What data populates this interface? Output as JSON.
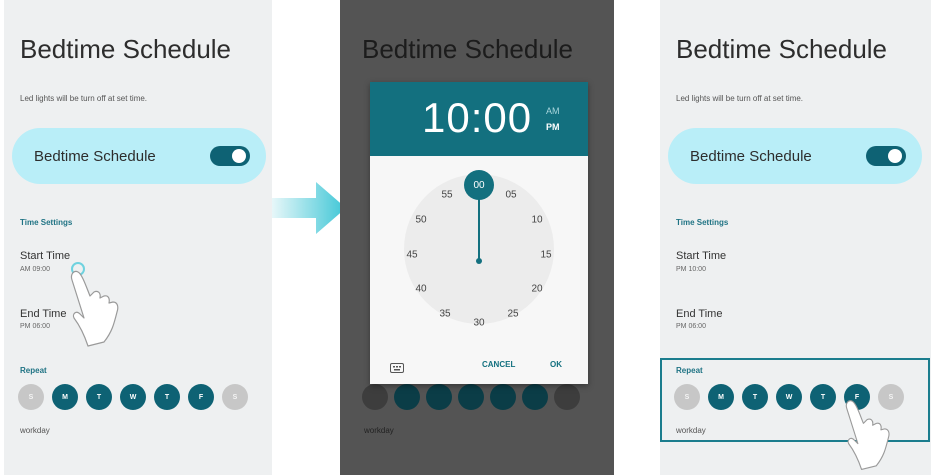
{
  "screen1": {
    "title": "Bedtime Schedule",
    "subtitle": "Led lights will be turn off at set time.",
    "toggle_label": "Bedtime Schedule",
    "section": "Time Settings",
    "start_label": "Start Time",
    "start_value": "AM 09:00",
    "end_label": "End Time",
    "end_value": "PM 06:00",
    "repeat_label": "Repeat",
    "days": [
      "S",
      "M",
      "T",
      "W",
      "T",
      "F",
      "S"
    ],
    "workday": "workday"
  },
  "screen2": {
    "title": "Bedtime Schedule",
    "time": "10:00",
    "am": "AM",
    "pm": "PM",
    "selected_minute": "00",
    "minutes": [
      "05",
      "10",
      "15",
      "20",
      "25",
      "30",
      "35",
      "40",
      "45",
      "50",
      "55"
    ],
    "cancel": "CANCEL",
    "ok": "OK",
    "workday": "workday"
  },
  "screen3": {
    "title": "Bedtime Schedule",
    "subtitle": "Led lights will be turn off at set time.",
    "toggle_label": "Bedtime Schedule",
    "section": "Time Settings",
    "start_label": "Start Time",
    "start_value": "PM 10:00",
    "end_label": "End Time",
    "end_value": "PM 06:00",
    "repeat_label": "Repeat",
    "days": [
      "S",
      "M",
      "T",
      "W",
      "T",
      "F",
      "S"
    ],
    "workday": "workday"
  },
  "colors": {
    "accent": "#13707f",
    "toggle_card": "#b9eef8",
    "arrow": "#3ec6d6"
  },
  "icons": [
    "hand-pointer-icon",
    "arrow-right-icon",
    "keyboard-icon"
  ]
}
